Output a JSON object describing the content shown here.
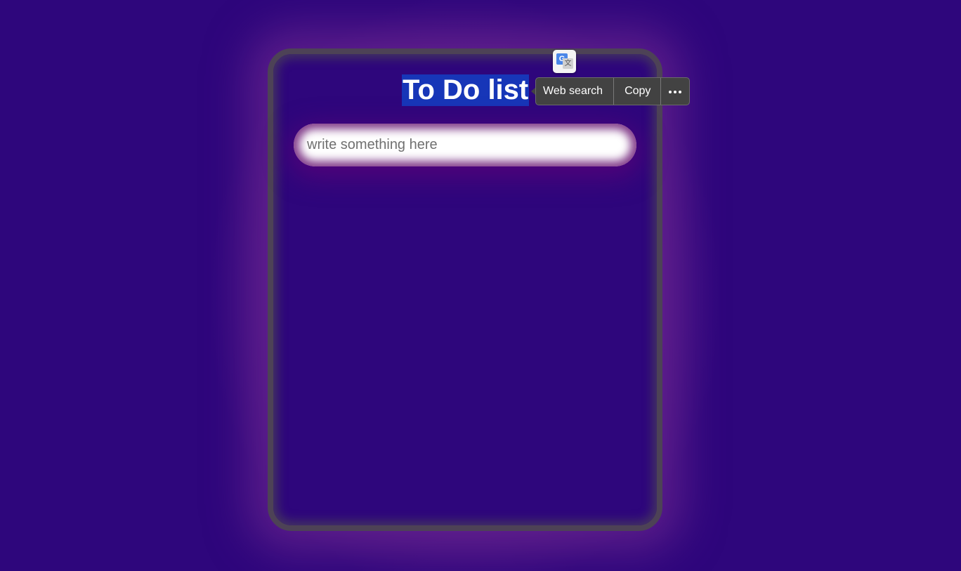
{
  "app": {
    "title": "To Do list"
  },
  "input": {
    "placeholder": "write something here",
    "value": ""
  },
  "selection_menu": {
    "translate_icon": "google-translate-icon",
    "items": [
      {
        "label": "Web search"
      },
      {
        "label": "Copy"
      }
    ],
    "more_icon": "more-horizontal-icon"
  },
  "colors": {
    "background": "#2e067c",
    "card_border": "#4d4256",
    "title_highlight": "#1736b8",
    "menu_bg": "#424242"
  }
}
